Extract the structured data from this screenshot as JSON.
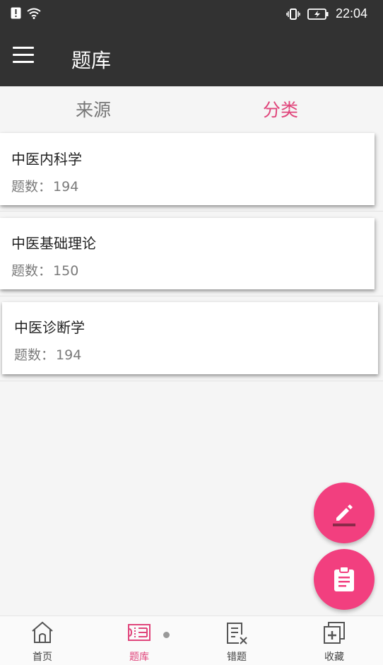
{
  "status_bar": {
    "time": "22:04"
  },
  "app_bar": {
    "title": "题库"
  },
  "tabs": [
    {
      "label": "来源",
      "active": false
    },
    {
      "label": "分类",
      "active": true
    }
  ],
  "cards": [
    {
      "title": "中医内科学",
      "count_label": "题数：",
      "count": "194"
    },
    {
      "title": "中医基础理论",
      "count_label": "题数：",
      "count": "150"
    },
    {
      "title": "中医诊断学",
      "count_label": "题数：",
      "count": "194"
    }
  ],
  "bottom_nav": [
    {
      "label": "首页",
      "icon": "home-icon"
    },
    {
      "label": "题库",
      "icon": "question-bank-icon",
      "active": true
    },
    {
      "label": "错题",
      "icon": "wrong-questions-icon"
    },
    {
      "label": "收藏",
      "icon": "favorites-icon"
    }
  ],
  "colors": {
    "accent": "#e0457b",
    "fab": "#f23f7f",
    "appbar": "#323232"
  }
}
